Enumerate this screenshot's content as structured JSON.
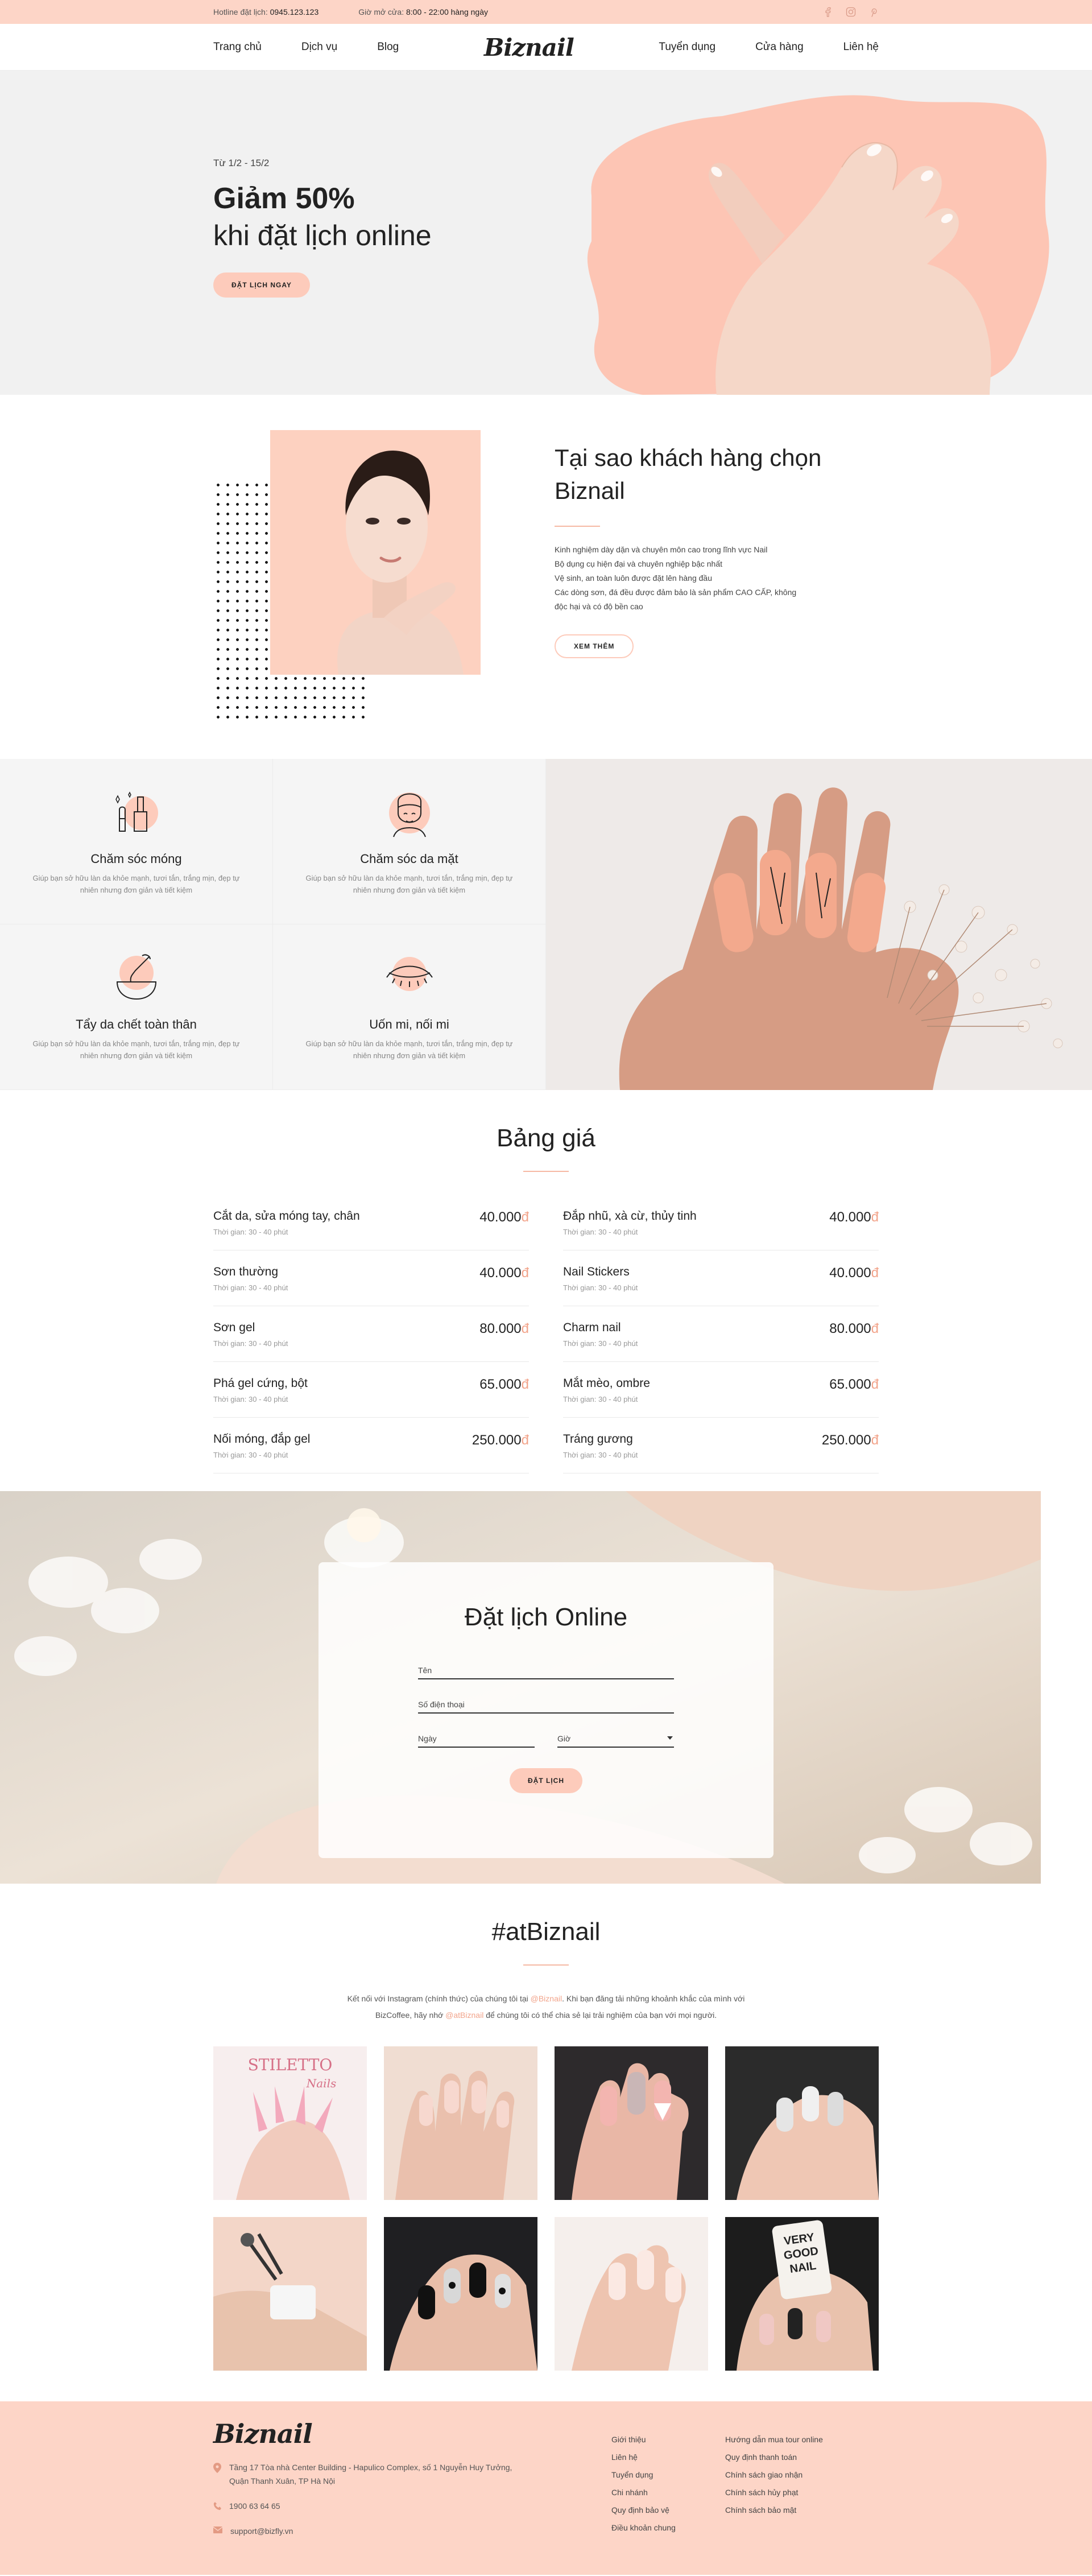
{
  "topbar": {
    "hotline_label": "Hotline đặt lịch:",
    "hotline_value": "0945.123.123",
    "hours_label": "Giờ mở cửa:",
    "hours_value": "8:00 - 22:00 hàng ngày",
    "social": [
      "facebook-icon",
      "instagram-icon",
      "pinterest-icon"
    ]
  },
  "nav": {
    "left": [
      "Trang chủ",
      "Dịch vụ",
      "Blog"
    ],
    "logo": "Biznail",
    "right": [
      "Tuyển dụng",
      "Cửa hàng",
      "Liên hệ"
    ]
  },
  "hero": {
    "date": "Từ 1/2 - 15/2",
    "headline": "Giảm 50%",
    "subheadline": "khi đặt lịch online",
    "cta": "ĐẶT LỊCH NGAY"
  },
  "why": {
    "title_line1": "Tại sao khách hàng chọn",
    "title_line2": "Biznail",
    "points": [
      "Kinh nghiệm dày dặn và chuyên môn cao trong lĩnh vực Nail",
      "Bộ dụng cụ hiện đại và chuyên nghiệp bậc nhất",
      "Vệ sinh, an toàn luôn được đặt lên hàng đầu",
      "Các dòng sơn, đá đều được đảm bảo là sản phẩm CAO CẤP, không",
      "độc hại và có độ bền cao"
    ],
    "cta": "XEM THÊM"
  },
  "services": [
    {
      "icon": "nail-polish-icon",
      "title": "Chăm sóc móng",
      "desc_line1": "Giúp bạn sở hữu làn da khỏe mạnh, tươi tắn, trắng mịn, đẹp tự",
      "desc_line2": "nhiên nhưng đơn giản và tiết kiệm"
    },
    {
      "icon": "face-care-icon",
      "title": "Chăm sóc da mặt",
      "desc_line1": "Giúp bạn sở hữu làn da khỏe mạnh, tươi tắn, trắng mịn, đẹp tự",
      "desc_line2": "nhiên nhưng đơn giản và tiết kiệm"
    },
    {
      "icon": "wax-bowl-icon",
      "title": "Tẩy da chết toàn thân",
      "desc_line1": "Giúp bạn sở hữu làn da khỏe mạnh, tươi tắn, trắng mịn, đẹp tự",
      "desc_line2": "nhiên nhưng đơn giản và tiết kiệm"
    },
    {
      "icon": "eyelash-icon",
      "title": "Uốn mi, nối mi",
      "desc_line1": "Giúp bạn sở hữu làn da khỏe mạnh, tươi tắn, trắng mịn, đẹp tự",
      "desc_line2": "nhiên nhưng đơn giản và tiết kiệm"
    }
  ],
  "prices": {
    "title": "Bảng giá",
    "currency": "đ",
    "items": [
      {
        "name": "Cắt da, sửa móng tay, chân",
        "time": "Thời gian: 30 - 40 phút",
        "price": "40.000"
      },
      {
        "name": "Đắp nhũ, xà cừ, thủy tinh",
        "time": "Thời gian: 30 - 40 phút",
        "price": "40.000"
      },
      {
        "name": "Sơn thường",
        "time": "Thời gian: 30 - 40 phút",
        "price": "40.000"
      },
      {
        "name": "Nail Stickers",
        "time": "Thời gian: 30 - 40 phút",
        "price": "40.000"
      },
      {
        "name": "Sơn gel",
        "time": "Thời gian: 30 - 40 phút",
        "price": "80.000"
      },
      {
        "name": "Charm nail",
        "time": "Thời gian: 30 - 40 phút",
        "price": "80.000"
      },
      {
        "name": "Phá gel cứng, bột",
        "time": "Thời gian: 30 - 40 phút",
        "price": "65.000"
      },
      {
        "name": "Mắt mèo, ombre",
        "time": "Thời gian: 30 - 40 phút",
        "price": "65.000"
      },
      {
        "name": "Nối móng, đắp gel",
        "time": "Thời gian: 30 - 40 phút",
        "price": "250.000"
      },
      {
        "name": "Tráng gương",
        "time": "Thời gian: 30 - 40 phút",
        "price": "250.000"
      }
    ]
  },
  "booking": {
    "title": "Đặt lịch Online",
    "name_placeholder": "Tên",
    "phone_placeholder": "Số điện thoại",
    "date_placeholder": "Ngày",
    "time_placeholder": "Giờ",
    "submit": "ĐẶT LỊCH"
  },
  "instagram": {
    "title": "#atBiznail",
    "desc_part1": "Kết nối với Instagram (chính thức) của chúng tôi tại ",
    "handle1": "@Biznail",
    "desc_part2": ". Khi bạn đăng tải những khoảnh khắc của mình với",
    "desc_part3": "BizCoffee, hãy nhớ ",
    "handle2": "@atBiznail",
    "desc_part4": " để chúng tôi có thể chia sẻ lại trải nghiệm của bạn với mọi người.",
    "tile1_text": "STILETTO",
    "tile1_script": "Nails",
    "tile8_text1": "VERY",
    "tile8_text2": "GOOD",
    "tile8_text3": "NAIL"
  },
  "footer": {
    "logo": "Biznail",
    "address_line1": "Tầng 17 Tòa nhà Center Building - Hapulico Complex, số 1 Nguyễn Huy Tưởng,",
    "address_line2": "Quận Thanh Xuân, TP Hà Nội",
    "phone": "1900 63 64 65",
    "email": "support@bizfly.vn",
    "col1": [
      "Giới thiệu",
      "Liên hệ",
      "Tuyển dụng",
      "Chi nhánh",
      "Quy định bảo vệ",
      "Điều khoản chung"
    ],
    "col2": [
      "Hướng dẫn mua tour online",
      "Quy định thanh toán",
      "Chính sách giao nhận",
      "Chính sách hủy phạt",
      "Chính sách bảo mật"
    ]
  },
  "colors": {
    "accent": "#fdcbbb",
    "accent_text": "#f2a48b",
    "footer_bg": "#fdd5c7"
  }
}
